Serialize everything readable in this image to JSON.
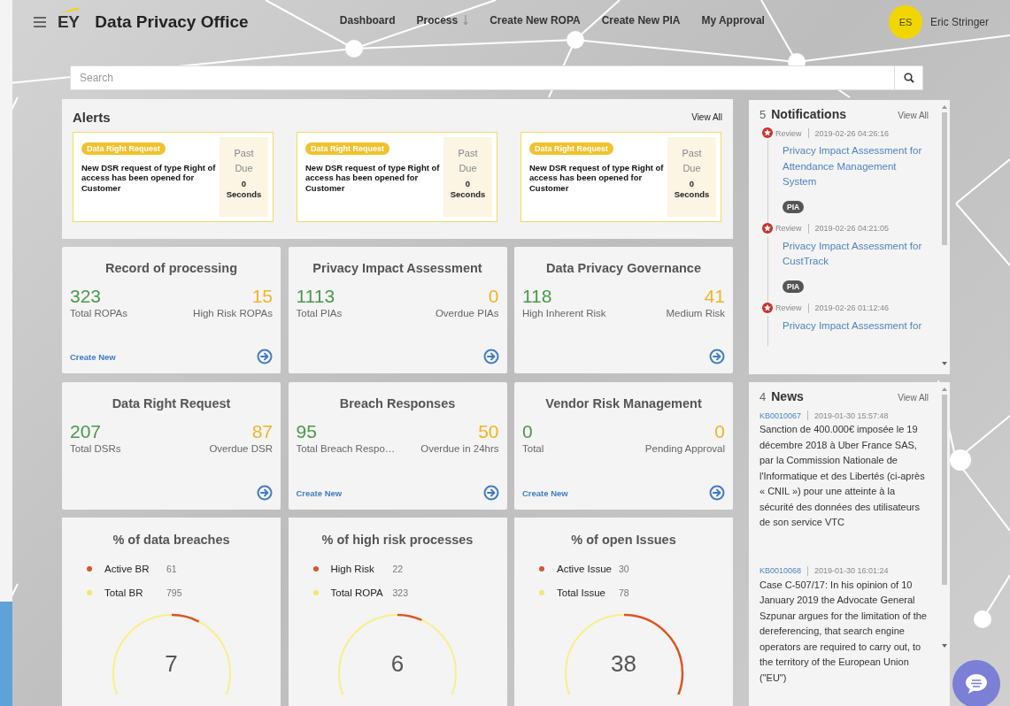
{
  "header": {
    "brand_logo": "EY",
    "title": "Data Privacy Office",
    "nav": [
      {
        "label": "Dashboard",
        "has_menu": false
      },
      {
        "label": "Process",
        "has_menu": true
      },
      {
        "label": "Create New ROPA",
        "has_menu": false
      },
      {
        "label": "Create New PIA",
        "has_menu": false
      },
      {
        "label": "My Approval",
        "has_menu": false
      }
    ],
    "user": {
      "initials": "ES",
      "name": "Eric Stringer"
    }
  },
  "search": {
    "placeholder": "Search"
  },
  "alerts": {
    "title": "Alerts",
    "view_all": "View All",
    "items": [
      {
        "tag": "Data Right Request",
        "message": "New DSR request of type Right of access has been opened for Customer",
        "due_label": "Past Due",
        "due_value": "0",
        "due_unit": "Seconds"
      },
      {
        "tag": "Data Right Request",
        "message": "New DSR request of type Right of access has been opened for Customer",
        "due_label": "Past Due",
        "due_value": "0",
        "due_unit": "Seconds"
      },
      {
        "tag": "Data Right Request",
        "message": "New DSR request of type Right of access has been opened for Customer",
        "due_label": "Past Due",
        "due_value": "0",
        "due_unit": "Seconds"
      }
    ]
  },
  "stat_cards": [
    {
      "title": "Record of processing",
      "primary_value": "323",
      "primary_label": "Total ROPAs",
      "secondary_value": "15",
      "secondary_label": "High Risk ROPAs",
      "create_link": "Create New"
    },
    {
      "title": "Privacy Impact Assessment",
      "primary_value": "1113",
      "primary_label": "Total PIAs",
      "secondary_value": "0",
      "secondary_label": "Overdue PIAs"
    },
    {
      "title": "Data Privacy Governance",
      "primary_value": "118",
      "primary_label": "High Inherent Risk",
      "secondary_value": "41",
      "secondary_label": "Medium Risk"
    },
    {
      "title": "Data Right Request",
      "primary_value": "207",
      "primary_label": "Total DSRs",
      "secondary_value": "87",
      "secondary_label": "Overdue DSR"
    },
    {
      "title": "Breach Responses",
      "primary_value": "95",
      "primary_label": "Total Breach Respo…",
      "secondary_value": "50",
      "secondary_label": "Overdue in 24hrs",
      "create_link": "Create New"
    },
    {
      "title": "Vendor Risk Management",
      "primary_value": "0",
      "primary_label": "Total",
      "secondary_value": "0",
      "secondary_label": "Pending Approval",
      "create_link": "Create New"
    }
  ],
  "gauge_cards": [
    {
      "title": "% of data breaches",
      "legend": [
        {
          "label": "Active BR",
          "value": "61",
          "color": "#d9562b"
        },
        {
          "label": "Total BR",
          "value": "795",
          "color": "#f5e66b"
        }
      ],
      "level": 0.077,
      "center_value": "7"
    },
    {
      "title": "% of high risk processes",
      "legend": [
        {
          "label": "High Risk",
          "value": "22",
          "color": "#d9562b"
        },
        {
          "label": "Total ROPA",
          "value": "323",
          "color": "#f5e66b"
        }
      ],
      "level": 0.068,
      "center_value": "6"
    },
    {
      "title": "% of open Issues",
      "legend": [
        {
          "label": "Active Issue",
          "value": "30",
          "color": "#d9562b"
        },
        {
          "label": "Total Issue",
          "value": "78",
          "color": "#f5e66b"
        }
      ],
      "level": 0.385,
      "center_value": "38"
    }
  ],
  "notifications": {
    "count": "5",
    "title": "Notifications",
    "view_all": "View All",
    "items": [
      {
        "status": "Review",
        "time": "2019-02-26 04:26:16",
        "title": "Privacy Impact Assessment for Attendance Management System",
        "tag": "PIA"
      },
      {
        "status": "Review",
        "time": "2019-02-26 04:21:05",
        "title": "Privacy Impact Assessment for CustTrack",
        "tag": "PIA"
      },
      {
        "status": "Review",
        "time": "2019-02-26 01:12:46",
        "title": "Privacy Impact Assessment for"
      }
    ]
  },
  "news": {
    "count": "4",
    "title": "News",
    "view_all": "View All",
    "items": [
      {
        "id": "KB0010067",
        "time": "2019-01-30 15:57:48",
        "text": "Sanction de 400.000€ imposée le 19 décembre 2018 à Uber France SAS, par la Commission Nationale de l'Informatique et des Libertés (ci-après « CNIL ») pour une atteinte à la sécurité des données des utilisateurs de son service VTC"
      },
      {
        "id": "KB0010068",
        "time": "2019-01-30 16:01:24",
        "text": "Case C-507/17: In his opinion of 10 January 2019 the Advocate General Szpunar argues for the limitation of the dereferencing, that search engine operators are required to carry out, to the territory of the European Union (\"EU\")"
      }
    ]
  }
}
